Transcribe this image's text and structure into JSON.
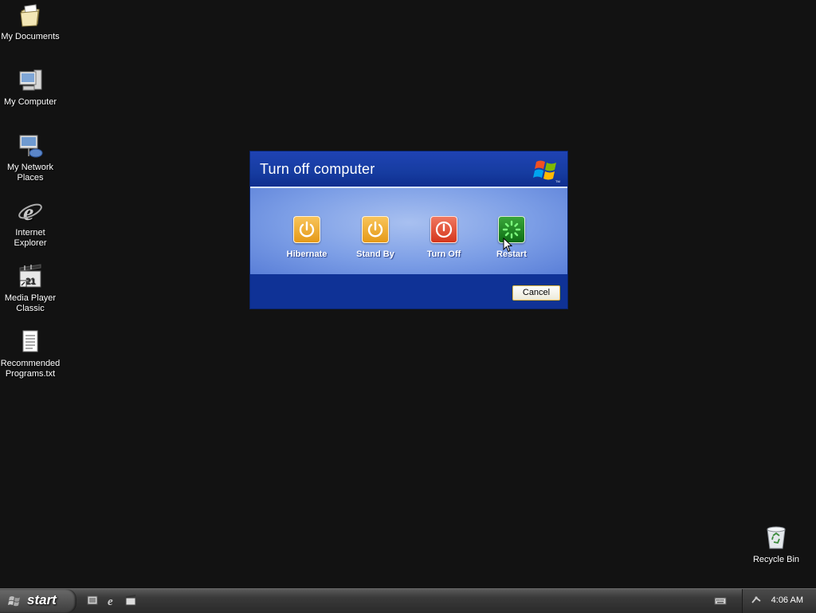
{
  "desktop": {
    "icons": [
      {
        "label": "My Documents",
        "icon": "my-documents-icon"
      },
      {
        "label": "My Computer",
        "icon": "my-computer-icon"
      },
      {
        "label": "My Network Places",
        "icon": "my-network-places-icon"
      },
      {
        "label": "Internet Explorer",
        "icon": "internet-explorer-icon"
      },
      {
        "label": "Media Player Classic",
        "icon": "media-player-classic-icon"
      },
      {
        "label": "Recommended Programs.txt",
        "icon": "text-file-icon"
      }
    ],
    "recycle_bin": {
      "label": "Recycle Bin",
      "icon": "recycle-bin-icon"
    }
  },
  "dialog": {
    "title": "Turn off computer",
    "options": [
      {
        "label": "Hibernate",
        "icon": "hibernate-icon",
        "color": "#e59a18"
      },
      {
        "label": "Stand By",
        "icon": "stand-by-icon",
        "color": "#e59a18"
      },
      {
        "label": "Turn Off",
        "icon": "turn-off-icon",
        "color": "#d5361c"
      },
      {
        "label": "Restart",
        "icon": "restart-icon",
        "color": "#0e6e14"
      }
    ],
    "cancel_label": "Cancel"
  },
  "taskbar": {
    "start_label": "start",
    "quick_launch": [
      "show-desktop-icon",
      "internet-explorer-icon",
      "media-player-classic-icon"
    ],
    "clock": "4:06 AM"
  }
}
